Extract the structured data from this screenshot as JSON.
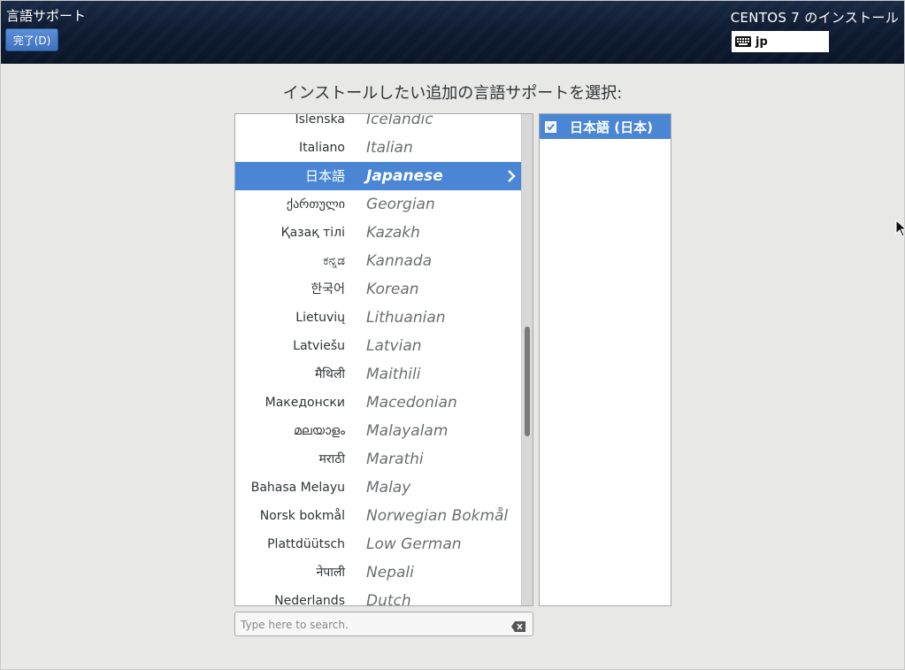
{
  "header": {
    "title": "言語サポート",
    "done_label": "完了(D)",
    "product": "CENTOS 7 のインストール",
    "keyboard_layout": "jp"
  },
  "prompt": "インストールしたい追加の言語サポートを選択:",
  "languages": [
    {
      "native": "Íslenska",
      "english": "Icelandic"
    },
    {
      "native": "Italiano",
      "english": "Italian"
    },
    {
      "native": "日本語",
      "english": "Japanese",
      "selected": true
    },
    {
      "native": "ქართული",
      "english": "Georgian"
    },
    {
      "native": "Қазақ тілі",
      "english": "Kazakh"
    },
    {
      "native": "ಕನ್ನಡ",
      "english": "Kannada"
    },
    {
      "native": "한국어",
      "english": "Korean"
    },
    {
      "native": "Lietuvių",
      "english": "Lithuanian"
    },
    {
      "native": "Latviešu",
      "english": "Latvian"
    },
    {
      "native": "मैथिली",
      "english": "Maithili"
    },
    {
      "native": "Македонски",
      "english": "Macedonian"
    },
    {
      "native": "മലയാളം",
      "english": "Malayalam"
    },
    {
      "native": "मराठी",
      "english": "Marathi"
    },
    {
      "native": "Bahasa Melayu",
      "english": "Malay"
    },
    {
      "native": "Norsk bokmål",
      "english": "Norwegian Bokmål"
    },
    {
      "native": "Plattdüütsch",
      "english": "Low German"
    },
    {
      "native": "नेपाली",
      "english": "Nepali"
    },
    {
      "native": "Nederlands",
      "english": "Dutch"
    }
  ],
  "selected_locales": [
    {
      "label": "日本語 (日本)",
      "checked": true
    }
  ],
  "search": {
    "placeholder": "Type here to search.",
    "value": ""
  },
  "colors": {
    "accent": "#4a86d4",
    "header_bg": "#0f1c33",
    "background": "#e8e8e7"
  },
  "icons": [
    "keyboard-icon",
    "chevron-right-icon",
    "checkbox-icon",
    "clear-search-icon",
    "mouse-cursor-icon"
  ]
}
